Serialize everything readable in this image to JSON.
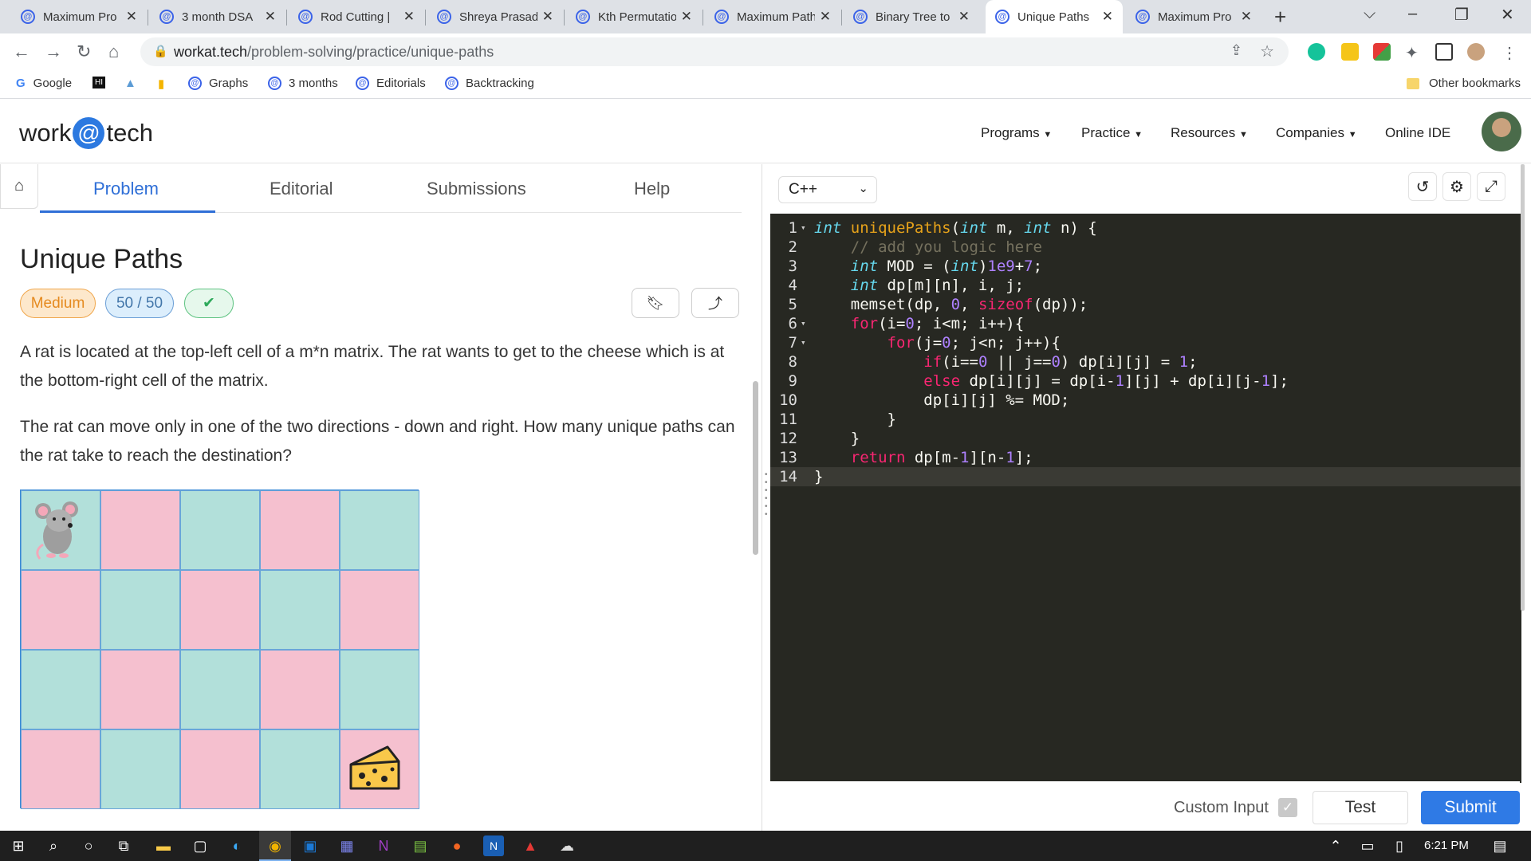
{
  "browser": {
    "tabs": [
      {
        "label": "Maximum Pro",
        "active": false
      },
      {
        "label": "3 month DSA",
        "active": false
      },
      {
        "label": "Rod Cutting |",
        "active": false
      },
      {
        "label": "Shreya Prasad",
        "active": false
      },
      {
        "label": "Kth Permutatio",
        "active": false
      },
      {
        "label": "Maximum Path",
        "active": false
      },
      {
        "label": "Binary Tree to",
        "active": false
      },
      {
        "label": "Unique Paths",
        "active": true
      },
      {
        "label": "Maximum Pro",
        "active": false
      }
    ],
    "url_host": "workat.tech",
    "url_path": "/problem-solving/practice/unique-paths",
    "bookmarks": [
      "Google",
      "Graphs",
      "3 months",
      "Editorials",
      "Backtracking"
    ],
    "other_bookmarks": "Other bookmarks"
  },
  "site": {
    "logo_left": "work",
    "logo_at": "@",
    "logo_right": "tech",
    "nav": [
      "Programs",
      "Practice",
      "Resources",
      "Companies",
      "Online IDE"
    ]
  },
  "problem": {
    "tabs": [
      "Problem",
      "Editorial",
      "Submissions",
      "Help"
    ],
    "active_tab": "Problem",
    "title": "Unique Paths",
    "difficulty": "Medium",
    "score": "50 / 50",
    "paragraphs": [
      "A rat is located at the top-left cell of a m*n matrix. The rat wants to get to the cheese which is at the bottom-right cell of the matrix.",
      "The rat can move only in one of the two directions - down and right. How many unique paths can the rat take to reach the destination?"
    ],
    "grid": {
      "rows": 4,
      "cols": 5,
      "color_a": "#b2e0da",
      "color_b": "#f5c0cf"
    }
  },
  "editor": {
    "language": "C++",
    "lines": [
      "int uniquePaths(int m, int n) {",
      "    // add you logic here",
      "    int MOD = (int)1e9+7;",
      "    int dp[m][n], i, j;",
      "    memset(dp, 0, sizeof(dp));",
      "    for(i=0; i<m; i++){",
      "        for(j=0; j<n; j++){",
      "            if(i==0 || j==0) dp[i][j] = 1;",
      "            else dp[i][j] = dp[i-1][j] + dp[i][j-1];",
      "            dp[i][j] %= MOD;",
      "        }",
      "    }",
      "    return dp[m-1][n-1];",
      "}"
    ]
  },
  "actions": {
    "custom_input": "Custom Input",
    "test": "Test",
    "submit": "Submit"
  },
  "taskbar": {
    "time": "6:21 PM"
  },
  "colors": {
    "accent": "#2f6fd7",
    "submit": "#2f7ae5",
    "editor_bg": "#272822"
  }
}
